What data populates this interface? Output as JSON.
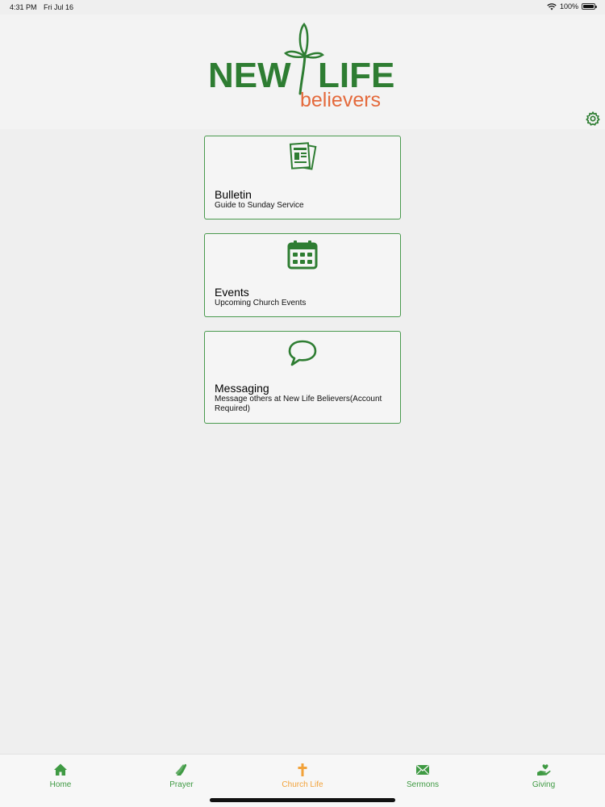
{
  "status_bar": {
    "time": "4:31 PM",
    "date": "Fri Jul 16",
    "battery": "100%",
    "battery_level": 1.0
  },
  "logo": {
    "word1": "NEW",
    "word2": "LIFE",
    "word3": "believers"
  },
  "settings": {
    "icon": "gear-icon"
  },
  "cards": [
    {
      "title": "Bulletin",
      "subtitle": "Guide to Sunday Service",
      "icon": "bulletin-icon"
    },
    {
      "title": "Events",
      "subtitle": "Upcoming Church Events",
      "icon": "calendar-icon"
    },
    {
      "title": "Messaging",
      "subtitle": "Message others at New Life Believers(Account Required)",
      "icon": "speech-bubble-icon"
    }
  ],
  "tabs": [
    {
      "label": "Home",
      "icon": "house-icon",
      "active": false
    },
    {
      "label": "Prayer",
      "icon": "praying-hands-icon",
      "active": false
    },
    {
      "label": "Church Life",
      "icon": "cross-icon",
      "active": true
    },
    {
      "label": "Sermons",
      "icon": "envelope-icon",
      "active": false
    },
    {
      "label": "Giving",
      "icon": "giving-hand-icon",
      "active": false
    }
  ],
  "colors": {
    "brand_green": "#2e7d32",
    "accent_orange": "#e46a3c",
    "active_tab": "#f2a23a",
    "tab_green": "#3f9a43"
  }
}
